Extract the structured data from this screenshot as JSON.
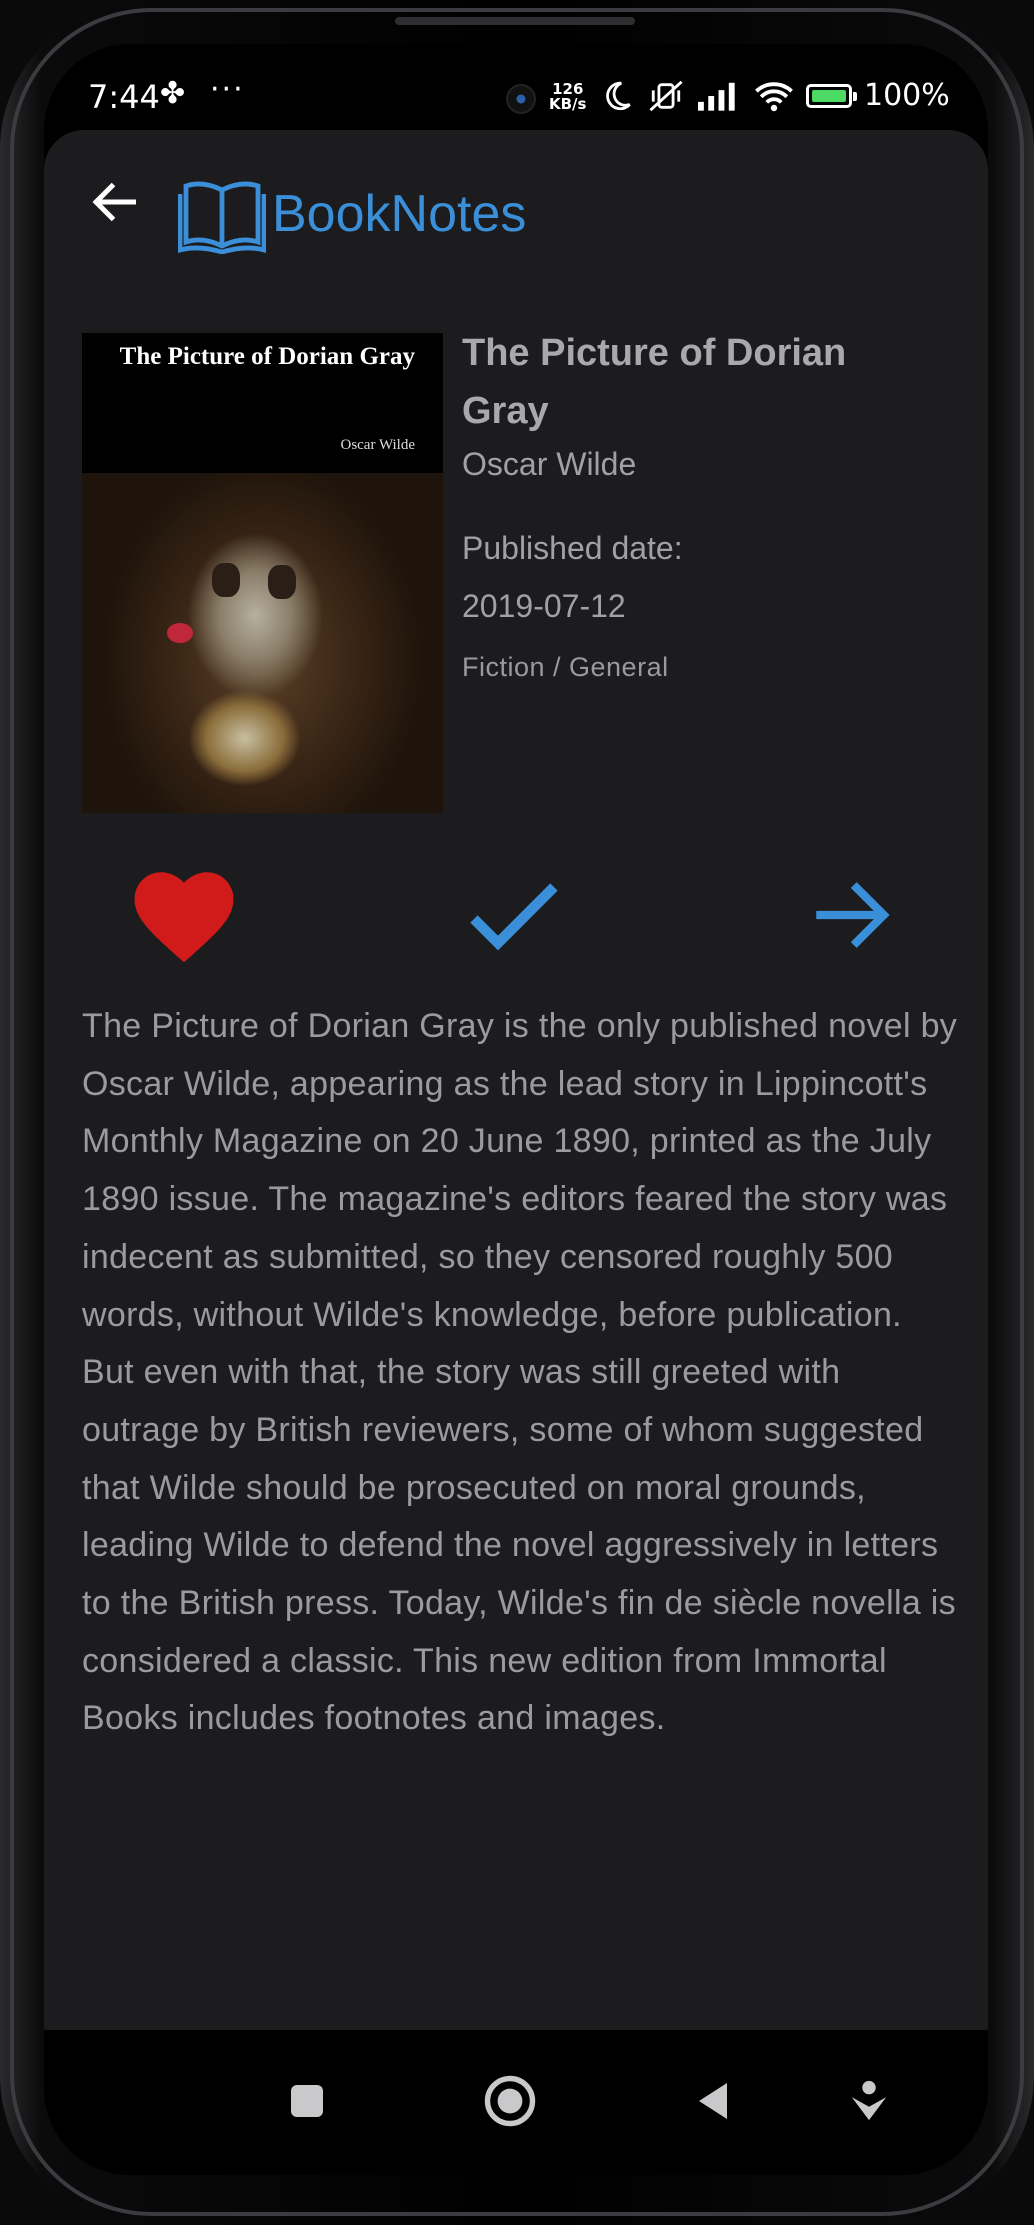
{
  "status_bar": {
    "time": "7:44",
    "fan_glyph": "✤",
    "dots": "···",
    "net_speed_value": "126",
    "net_speed_unit": "KB/s",
    "battery_percent": "100%"
  },
  "header": {
    "app_name": "BookNotes",
    "back_icon": "arrow-left-icon",
    "logo_icon": "book-open-icon"
  },
  "book": {
    "cover": {
      "title_text": "The Picture of Dorian Gray",
      "author_text": "Oscar Wilde"
    },
    "title": "The Picture of Dorian Gray",
    "author": "Oscar Wilde",
    "published_label": "Published date:",
    "published_date": "2019-07-12",
    "category": "Fiction / General",
    "description": "The Picture of Dorian Gray is the only published novel by Oscar Wilde, appearing as the lead story in Lippincott's Monthly Magazine on 20 June 1890, printed as the July 1890 issue. The magazine's editors feared the story was indecent as submitted, so they censored roughly 500 words, without Wilde's knowledge, before publication. But even with that, the story was still greeted with outrage by British reviewers, some of whom suggested that Wilde should be prosecuted on moral grounds, leading Wilde to defend the novel aggressively in letters to the British press. Today, Wilde's fin de siècle novella is considered a classic. This new edition from Immortal Books includes footnotes and images."
  },
  "actions": {
    "favorite_icon": "heart-icon",
    "read_icon": "check-icon",
    "next_icon": "arrow-right-icon"
  },
  "colors": {
    "accent": "#3a8fd8",
    "favorite": "#d11a1a",
    "background": "#1c1c1e",
    "text_muted": "#a1a1a5"
  },
  "nav_bar": {
    "recents_icon": "square-icon",
    "home_icon": "circle-home-icon",
    "back_icon": "triangle-back-icon",
    "extra_icon": "accessibility-icon"
  }
}
